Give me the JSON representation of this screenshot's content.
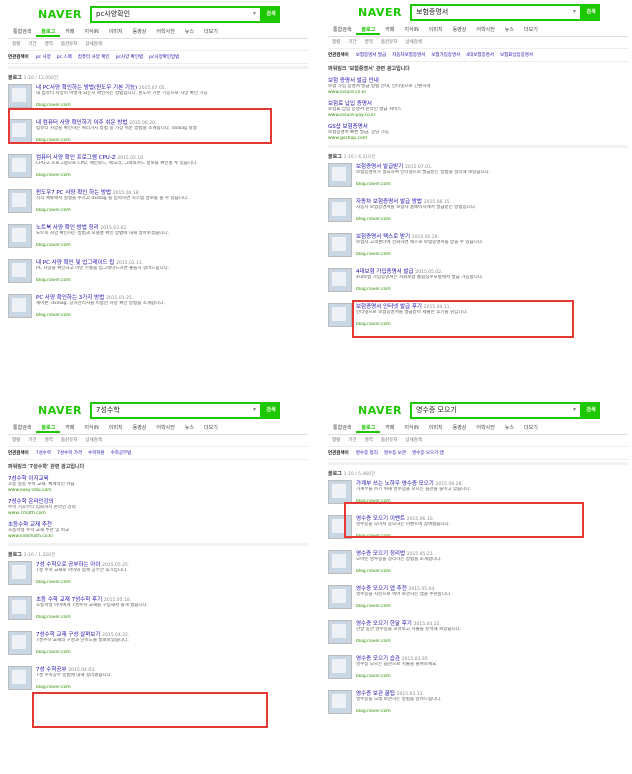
{
  "common": {
    "logo": "NAVER",
    "search_button": "검색",
    "keyboard_icon": "keyboard-icon",
    "blog_section_label": "블로그",
    "more_tools_label": "검색옵션"
  },
  "panels": [
    {
      "query": "pc사양확인",
      "tabs": [
        "통합검색",
        "블로그",
        "카페",
        "지식iN",
        "이미지",
        "동영상",
        "어학사전",
        "뉴스",
        "더보기"
      ],
      "active_tab": 1,
      "options": [
        "정렬",
        "기간",
        "영역",
        "옵션유지",
        "상세검색"
      ],
      "related_label": "연관검색어",
      "related": [
        "pc 사양",
        "pc 스펙",
        "컴퓨터 사양 확인",
        "pc사양 확인법",
        "pc사양확인방법"
      ],
      "blog_count": "1-10 / 12,000건",
      "items": [
        {
          "title": "내 PC사양 확인하는 방법(윈도우 기본 기능)",
          "date": "2015.07.05.",
          "snippet": "내 컴퓨터 사양이 어떻게 되는지 확인하는 방법입니다. 윈도우 기본 기능으로 사양 확인 가능",
          "url": "blog.naver.com"
        },
        {
          "title": "내 컴퓨터 사양 확인하기 아주 쉬운 방법",
          "date": "2015.06.20.",
          "snippet": "컴퓨터 사양을 확인하는 여러가지 방법 중 가장 쉬운 방법을 소개합니다. dxdiag 실행",
          "url": "blog.naver.com"
        },
        {
          "title": "컴퓨터 사양 확인 프로그램 CPU-Z",
          "date": "2015.05.10.",
          "snippet": "CPU-Z 프로그램으로 CPU, 메인보드, 메모리, 그래픽카드 정보를 확인할 수 있습니다.",
          "url": "blog.naver.com"
        },
        {
          "title": "윈도우7 PC 사양 확인 하는 방법",
          "date": "2015.04.18.",
          "snippet": "시작 메뉴에서 실행을 누르고 dxdiag 를 입력하면 시스템 정보를 볼 수 있습니다.",
          "url": "blog.naver.com"
        },
        {
          "title": "노트북 사양 확인 방법 정리",
          "date": "2015.03.02.",
          "snippet": "노트북 사양 확인하는 방법과 모델명 확인 방법에 대해 알아보겠습니다.",
          "url": "blog.naver.com"
        },
        {
          "title": "내 PC 사양 확인 및 업그레이드 팁",
          "date": "2015.02.11.",
          "snippet": "PC 사양을 확인하고 어떤 부품을 업그레이드하면 좋을지 알려드립니다.",
          "url": "blog.naver.com"
        },
        {
          "title": "PC 사양 확인하는 3가지 방법",
          "date": "2015.01.25.",
          "snippet": "제어판, dxdiag, 장치관리자를 이용한 사양 확인 방법을 소개합니다.",
          "url": "blog.naver.com"
        }
      ]
    },
    {
      "query": "보험증명서",
      "tabs": [
        "통합검색",
        "블로그",
        "카페",
        "지식iN",
        "이미지",
        "동영상",
        "어학사전",
        "뉴스",
        "더보기"
      ],
      "active_tab": 1,
      "options": [
        "정렬",
        "기간",
        "영역",
        "옵션유지",
        "상세검색"
      ],
      "related_label": "연관검색어",
      "related": [
        "보험증명서 발급",
        "자동차보험증명서",
        "보험가입증명서",
        "4대보험증명서",
        "보험료납입증명서"
      ],
      "ad_label": "파워링크 '보험증명서' 관련 광고입니다",
      "ads": [
        {
          "title": "보험 증명서 발급 안내",
          "snippet": "보험 가입 증명서 발급 방법 안내, 인터넷으로 간편하게",
          "url": "www.insure.co.kr"
        },
        {
          "title": "보험료 납입 증명서",
          "snippet": "보험료 납입 증명서 온라인 발급 서비스",
          "url": "www.insure-pay.co.kr"
        },
        {
          "title": "GS샵 보험증명서",
          "snippet": "보험증명서 빠른 발급, 상담 가능",
          "url": "www.gsshop.com"
        }
      ],
      "blog_count": "1-10 / 4,210건",
      "items": [
        {
          "title": "보험증명서 발급받기",
          "date": "2015.07.01.",
          "snippet": "보험증명서가 필요하여 인터넷으로 발급받는 방법을 정리해 보았습니다.",
          "url": "blog.naver.com"
        },
        {
          "title": "자동차 보험증명서 발급 방법",
          "date": "2015.06.15.",
          "snippet": "자동차 보험증명서를 보험사 홈페이지에서 발급받는 방법입니다.",
          "url": "blog.naver.com"
        },
        {
          "title": "보험증명서 팩스로 받기",
          "date": "2015.05.28.",
          "snippet": "보험사 고객센터에 전화하면 팩스로 보험증명서를 받을 수 있습니다.",
          "url": "blog.naver.com"
        },
        {
          "title": "4대보험 가입증명서 발급",
          "date": "2015.05.02.",
          "snippet": "4대보험 가입증명서는 사회보험 통합징수포털에서 발급 가능합니다.",
          "url": "blog.naver.com"
        },
        {
          "title": "보험증명서 인터넷 발급 후기",
          "date": "2015.04.11.",
          "snippet": "인터넷으로 보험증명서를 발급받아 제출한 후기를 남깁니다.",
          "url": "blog.naver.com"
        }
      ]
    },
    {
      "query": "7성수학",
      "tabs": [
        "통합검색",
        "블로그",
        "카페",
        "지식iN",
        "이미지",
        "동영상",
        "어학사전",
        "뉴스",
        "더보기"
      ],
      "active_tab": 1,
      "options": [
        "정렬",
        "기간",
        "영역",
        "옵션유지",
        "상세검색"
      ],
      "related_label": "연관검색어",
      "related": [
        "7성수학",
        "7성수학 가격",
        "수학학원",
        "수학공부법"
      ],
      "ad_label": "파워링크 '7성수학' 관련 광고입니다",
      "ads": [
        {
          "title": "7성수학 이지교육",
          "snippet": "초등 중등 수학 교재, 체계적인 학습",
          "url": "www.easy-edu.com"
        },
        {
          "title": "7성수학 온라인강의",
          "snippet": "수학 기초부터 심화까지 온라인 강의",
          "url": "www.7math.com"
        },
        {
          "title": "초등수학 교재 추천",
          "snippet": "초등학생 수학 교재 추천 및 비교",
          "url": "www.kidsmath.co.kr"
        }
      ],
      "blog_count": "1-10 / 1,320건",
      "items": [
        {
          "title": "7성 수학으로 공부하는 아이",
          "date": "2015.05.25.",
          "snippet": "7성 수학 교재로 아이와 함께 공부한 후기입니다.",
          "url": "blog.naver.com"
        },
        {
          "title": "초등 수학 교재 7성수학 후기",
          "date": "2015.05.10.",
          "snippet": "초등학생 아이에게 7성수학 교재를 구입해서 풀게 했습니다.",
          "url": "blog.naver.com"
        },
        {
          "title": "7성수학 교재 구성 살펴보기",
          "date": "2015.04.22.",
          "snippet": "7성수학 교재의 구성과 난이도를 살펴보았습니다.",
          "url": "blog.naver.com"
        },
        {
          "title": "7성 수학공부",
          "date": "2015.04.03.",
          "snippet": "7성 수학공부 방법에 대해 정리했습니다.",
          "url": "blog.naver.com"
        }
      ]
    },
    {
      "query": "영수증 모으기",
      "tabs": [
        "통합검색",
        "블로그",
        "카페",
        "지식iN",
        "이미지",
        "동영상",
        "어학사전",
        "뉴스",
        "더보기"
      ],
      "active_tab": 1,
      "options": [
        "정렬",
        "기간",
        "영역",
        "옵션유지",
        "상세검색"
      ],
      "related_label": "연관검색어",
      "related": [
        "영수증 정리",
        "영수증 보관",
        "영수증 모으기 앱"
      ],
      "blog_count": "1-10 / 5,460건",
      "items": [
        {
          "title": "가계부 쓰는 노하우 영수증 모으기",
          "date": "2015.06.28.",
          "snippet": "가계부를 쓰기 위해 영수증을 모으는 습관을 들이고 있습니다.",
          "url": "blog.naver.com"
        },
        {
          "title": "영수증 모으기 이벤트",
          "date": "2015.06.10.",
          "snippet": "영수증을 모아서 응모하는 이벤트에 참여했습니다.",
          "url": "blog.naver.com"
        },
        {
          "title": "영수증 모으기 정리법",
          "date": "2015.05.21.",
          "snippet": "모아둔 영수증을 정리하는 방법을 소개합니다.",
          "url": "blog.naver.com"
        },
        {
          "title": "영수증 모으기 앱 추천",
          "date": "2015.05.04.",
          "snippet": "영수증을 사진으로 찍어 보관하는 앱을 추천합니다.",
          "url": "blog.naver.com"
        },
        {
          "title": "영수증 모으기 한달 후기",
          "date": "2015.04.15.",
          "snippet": "한달 동안 영수증을 모아보고 지출을 분석해 보았습니다.",
          "url": "blog.naver.com"
        },
        {
          "title": "영수증 모으기 습관",
          "date": "2015.03.30.",
          "snippet": "영수증 모으는 습관으로 지출을 줄여보세요.",
          "url": "blog.naver.com"
        },
        {
          "title": "영수증 보관 꿀팁",
          "date": "2015.03.12.",
          "snippet": "영수증을 오래 보관하는 방법을 알려드립니다.",
          "url": "blog.naver.com"
        }
      ]
    }
  ]
}
